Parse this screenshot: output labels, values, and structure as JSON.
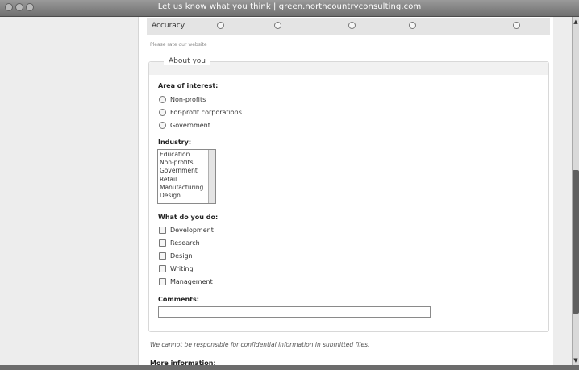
{
  "window": {
    "title": "Let us know what you think | green.northcountryconsulting.com"
  },
  "rating": {
    "row_label": "Accuracy",
    "note": "Please rate our website"
  },
  "about": {
    "legend": "About you",
    "area_label": "Area of interest:",
    "area_options": [
      "Non-profits",
      "For-profit corporations",
      "Government"
    ],
    "industry_label": "Industry:",
    "industry_options": [
      "Education",
      "Non-profits",
      "Government",
      "Retail",
      "Manufacturing",
      "Design"
    ],
    "do_label": "What do you do:",
    "do_options": [
      "Development",
      "Research",
      "Design",
      "Writing",
      "Management"
    ],
    "comments_label": "Comments:"
  },
  "disclaimer": "We cannot be responsible for confidential information in submitted files.",
  "more_info_label": "More information:",
  "icons": {
    "scroll_up": "scroll-up-arrow-icon",
    "scroll_down": "scroll-down-arrow-icon"
  }
}
